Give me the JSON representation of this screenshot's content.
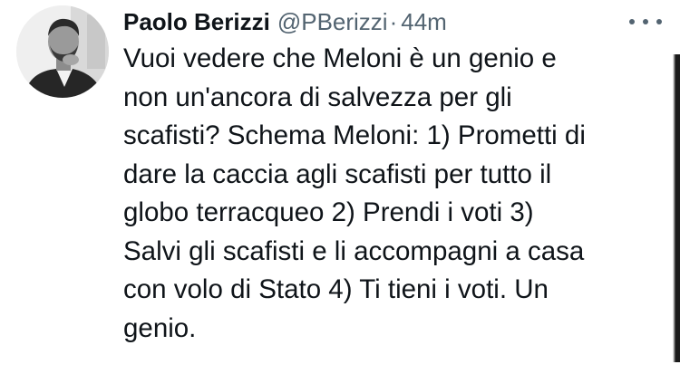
{
  "tweet": {
    "author_name": "Paolo Berizzi",
    "handle": "@PBerizzi",
    "separator": "·",
    "time": "44m",
    "more_icon": "more-horizontal-icon",
    "body": "Vuoi vedere che Meloni è un genio e\nnon un'ancora di salvezza per gli\nscafisti? Schema Meloni: 1) Prometti di\ndare la caccia agli scafisti per tutto il\nglobo terracqueo 2) Prendi i voti 3)\nSalvi gli scafisti e li accompagni a casa\ncon volo di Stato 4) Ti tieni i voti. Un\ngenio."
  },
  "colors": {
    "text": "#0f1419",
    "secondary": "#536471",
    "background": "#ffffff"
  }
}
